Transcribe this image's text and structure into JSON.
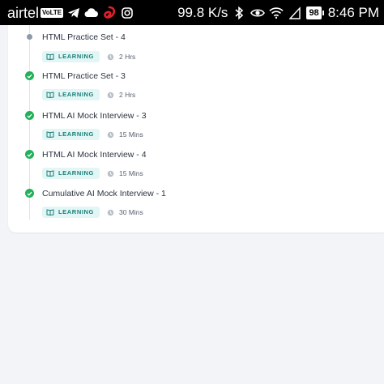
{
  "status_bar": {
    "carrier": "airtel",
    "volte_label": "VoLTE",
    "net_speed": "99.8 K/s",
    "battery": "98",
    "time": "8:46 PM"
  },
  "timeline": {
    "items": [
      {
        "title": "HTML Practice Set - 4",
        "tag": "LEARNING",
        "duration": "2 Hrs",
        "status": "pending"
      },
      {
        "title": "HTML Practice Set - 3",
        "tag": "LEARNING",
        "duration": "2 Hrs",
        "status": "completed"
      },
      {
        "title": "HTML AI Mock Interview - 3",
        "tag": "LEARNING",
        "duration": "15 Mins",
        "status": "completed"
      },
      {
        "title": "HTML AI Mock Interview - 4",
        "tag": "LEARNING",
        "duration": "15 Mins",
        "status": "completed"
      },
      {
        "title": "Cumulative AI Mock Interview - 1",
        "tag": "LEARNING",
        "duration": "30 Mins",
        "status": "completed"
      }
    ]
  },
  "colors": {
    "completed": "#22b05a",
    "pending": "#8e9aa8",
    "tag_bg": "#e2f6f5",
    "tag_text": "#1b7f78"
  }
}
